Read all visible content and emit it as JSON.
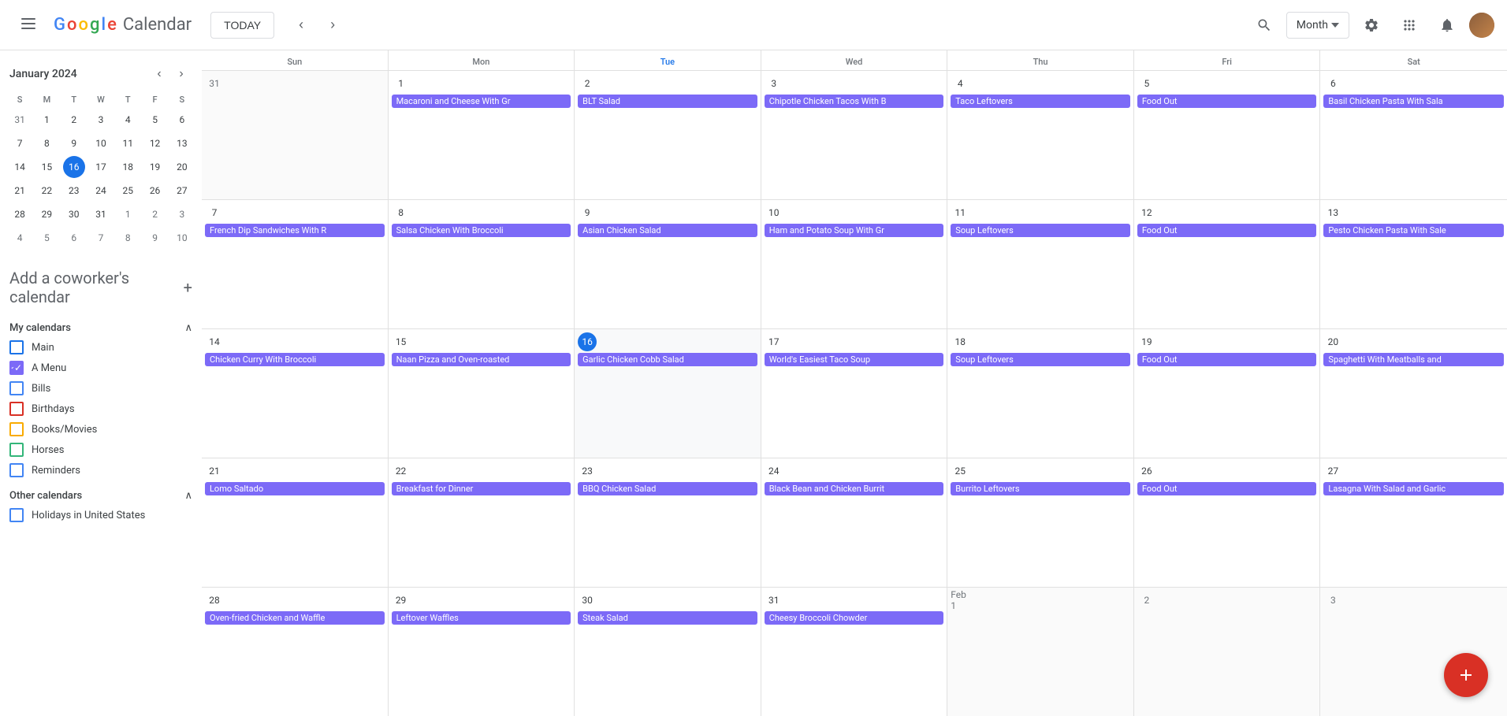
{
  "header": {
    "menu_label": "☰",
    "logo": {
      "g": "G",
      "o1": "o",
      "o2": "o",
      "g2": "g",
      "l": "l",
      "e": "e",
      "text": "Calendar"
    },
    "today_btn": "TODAY",
    "nav_prev": "‹",
    "nav_next": "›",
    "search_icon": "🔍",
    "month_selector": "Month",
    "settings_icon": "⚙",
    "apps_icon": "⠿",
    "notifications_icon": "🔔"
  },
  "sidebar": {
    "mini_cal": {
      "title": "January 2024",
      "nav_prev": "‹",
      "nav_next": "›",
      "day_headers": [
        "S",
        "M",
        "T",
        "W",
        "T",
        "F",
        "S"
      ],
      "weeks": [
        [
          {
            "day": "31",
            "other": true
          },
          {
            "day": "1"
          },
          {
            "day": "2"
          },
          {
            "day": "3"
          },
          {
            "day": "4"
          },
          {
            "day": "5"
          },
          {
            "day": "6"
          }
        ],
        [
          {
            "day": "7"
          },
          {
            "day": "8"
          },
          {
            "day": "9"
          },
          {
            "day": "10"
          },
          {
            "day": "11"
          },
          {
            "day": "12"
          },
          {
            "day": "13"
          }
        ],
        [
          {
            "day": "14"
          },
          {
            "day": "15"
          },
          {
            "day": "16",
            "today": true
          },
          {
            "day": "17"
          },
          {
            "day": "18"
          },
          {
            "day": "19"
          },
          {
            "day": "20"
          }
        ],
        [
          {
            "day": "21"
          },
          {
            "day": "22"
          },
          {
            "day": "23"
          },
          {
            "day": "24"
          },
          {
            "day": "25"
          },
          {
            "day": "26"
          },
          {
            "day": "27"
          }
        ],
        [
          {
            "day": "28"
          },
          {
            "day": "29"
          },
          {
            "day": "30"
          },
          {
            "day": "31"
          },
          {
            "day": "1",
            "other": true
          },
          {
            "day": "2",
            "other": true
          },
          {
            "day": "3",
            "other": true
          }
        ],
        [
          {
            "day": "4",
            "other": true
          },
          {
            "day": "5",
            "other": true
          },
          {
            "day": "6",
            "other": true
          },
          {
            "day": "7",
            "other": true
          },
          {
            "day": "8",
            "other": true
          },
          {
            "day": "9",
            "other": true
          },
          {
            "day": "10",
            "other": true
          }
        ]
      ]
    },
    "add_coworker": "Add a coworker's calendar",
    "my_calendars_title": "My calendars",
    "my_calendars": [
      {
        "label": "Main",
        "color": "blue",
        "checked": false
      },
      {
        "label": "A Menu",
        "color": "purple",
        "checked": true
      },
      {
        "label": "Bills",
        "color": "blue2",
        "checked": false
      },
      {
        "label": "Birthdays",
        "color": "red",
        "checked": false
      },
      {
        "label": "Books/Movies",
        "color": "orange",
        "checked": false
      },
      {
        "label": "Horses",
        "color": "green",
        "checked": false
      },
      {
        "label": "Reminders",
        "color": "blue2",
        "checked": false
      }
    ],
    "other_calendars_title": "Other calendars",
    "other_calendars": [
      {
        "label": "Holidays in United States",
        "color": "blue2",
        "checked": false
      }
    ]
  },
  "calendar": {
    "day_headers": [
      "Sun",
      "Mon",
      "Tue",
      "Wed",
      "Thu",
      "Fri",
      "Sat"
    ],
    "today_col": 2,
    "weeks": [
      {
        "days": [
          {
            "date": "31",
            "other": true,
            "events": []
          },
          {
            "date": "1",
            "events": [
              {
                "label": "Macaroni and Cheese With Gr"
              }
            ]
          },
          {
            "date": "2",
            "events": [
              {
                "label": "BLT Salad"
              }
            ]
          },
          {
            "date": "3",
            "events": [
              {
                "label": "Chipotle Chicken Tacos With B"
              }
            ]
          },
          {
            "date": "4",
            "events": [
              {
                "label": "Taco Leftovers"
              }
            ]
          },
          {
            "date": "5",
            "events": [
              {
                "label": "Food Out"
              }
            ]
          },
          {
            "date": "6",
            "events": [
              {
                "label": "Basil Chicken Pasta With Sala"
              }
            ]
          }
        ]
      },
      {
        "days": [
          {
            "date": "7",
            "events": [
              {
                "label": "French Dip Sandwiches With R"
              }
            ]
          },
          {
            "date": "8",
            "events": [
              {
                "label": "Salsa Chicken With Broccoli"
              }
            ]
          },
          {
            "date": "9",
            "events": [
              {
                "label": "Asian Chicken Salad"
              }
            ]
          },
          {
            "date": "10",
            "events": [
              {
                "label": "Ham and Potato Soup With Gr"
              }
            ]
          },
          {
            "date": "11",
            "events": [
              {
                "label": "Soup Leftovers"
              }
            ]
          },
          {
            "date": "12",
            "events": [
              {
                "label": "Food Out"
              }
            ]
          },
          {
            "date": "13",
            "events": [
              {
                "label": "Pesto Chicken Pasta With Sale"
              }
            ]
          }
        ]
      },
      {
        "days": [
          {
            "date": "14",
            "events": [
              {
                "label": "Chicken Curry With Broccoli"
              }
            ]
          },
          {
            "date": "15",
            "events": [
              {
                "label": "Naan Pizza and Oven-roasted"
              }
            ]
          },
          {
            "date": "16",
            "today": true,
            "events": [
              {
                "label": "Garlic Chicken Cobb Salad"
              }
            ]
          },
          {
            "date": "17",
            "events": [
              {
                "label": "World's Easiest Taco Soup"
              }
            ]
          },
          {
            "date": "18",
            "events": [
              {
                "label": "Soup Leftovers"
              }
            ]
          },
          {
            "date": "19",
            "events": [
              {
                "label": "Food Out"
              }
            ]
          },
          {
            "date": "20",
            "events": [
              {
                "label": "Spaghetti With Meatballs and"
              }
            ]
          }
        ]
      },
      {
        "days": [
          {
            "date": "21",
            "events": [
              {
                "label": "Lomo Saltado"
              }
            ]
          },
          {
            "date": "22",
            "events": [
              {
                "label": "Breakfast for Dinner"
              }
            ]
          },
          {
            "date": "23",
            "events": [
              {
                "label": "BBQ Chicken Salad"
              }
            ]
          },
          {
            "date": "24",
            "events": [
              {
                "label": "Black Bean and Chicken Burrit"
              }
            ]
          },
          {
            "date": "25",
            "events": [
              {
                "label": "Burrito Leftovers"
              }
            ]
          },
          {
            "date": "26",
            "events": [
              {
                "label": "Food Out"
              }
            ]
          },
          {
            "date": "27",
            "events": [
              {
                "label": "Lasagna With Salad and Garlic"
              }
            ]
          }
        ]
      },
      {
        "days": [
          {
            "date": "28",
            "events": [
              {
                "label": "Oven-fried Chicken and Waffle"
              }
            ]
          },
          {
            "date": "29",
            "events": [
              {
                "label": "Leftover Waffles"
              }
            ]
          },
          {
            "date": "30",
            "events": [
              {
                "label": "Steak Salad"
              }
            ]
          },
          {
            "date": "31",
            "events": [
              {
                "label": "Cheesy Broccoli Chowder"
              }
            ]
          },
          {
            "date": "Feb 1",
            "other": true,
            "events": []
          },
          {
            "date": "2",
            "other": true,
            "events": []
          },
          {
            "date": "3",
            "other": true,
            "events": []
          }
        ]
      }
    ]
  },
  "fab_label": "+"
}
